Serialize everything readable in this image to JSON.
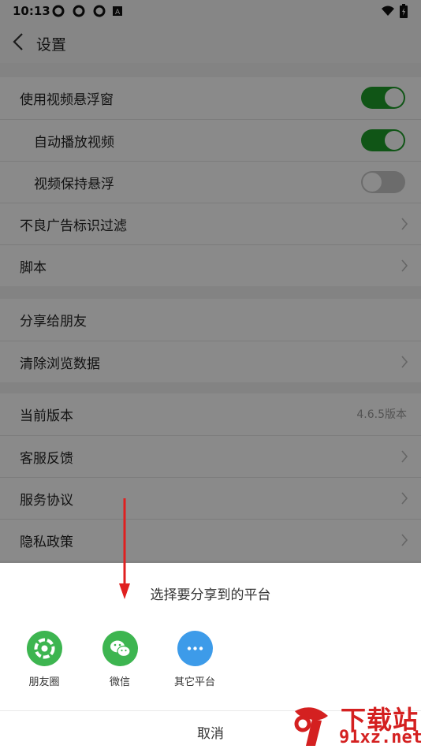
{
  "status_bar": {
    "time": "10:13"
  },
  "nav": {
    "title": "设置"
  },
  "section1": [
    {
      "label": "使用视频悬浮窗",
      "control": "switch",
      "on": true
    },
    {
      "label": "自动播放视频",
      "control": "switch",
      "on": true
    },
    {
      "label": "视频保持悬浮",
      "control": "switch",
      "on": false
    },
    {
      "label": "不良广告标识过滤",
      "control": "chevron"
    },
    {
      "label": "脚本",
      "control": "chevron"
    }
  ],
  "section2": [
    {
      "label": "分享给朋友"
    },
    {
      "label": "清除浏览数据"
    }
  ],
  "section3": [
    {
      "label": "当前版本",
      "value": "4.6.5版本"
    },
    {
      "label": "客服反馈"
    },
    {
      "label": "服务协议"
    },
    {
      "label": "隐私政策"
    }
  ],
  "share_sheet": {
    "title": "选择要分享到的平台",
    "options": [
      {
        "label": "朋友圈",
        "icon": "moments-icon",
        "color": "#3db550"
      },
      {
        "label": "微信",
        "icon": "wechat-icon",
        "color": "#3db550"
      },
      {
        "label": "其它平台",
        "icon": "more-icon",
        "color": "#3d9be9"
      }
    ],
    "cancel": "取消"
  },
  "watermark": {
    "main": "下载站",
    "sub": "91xz.net"
  },
  "colors": {
    "switch_on": "#1f9d2a",
    "arrow": "#e02020"
  }
}
